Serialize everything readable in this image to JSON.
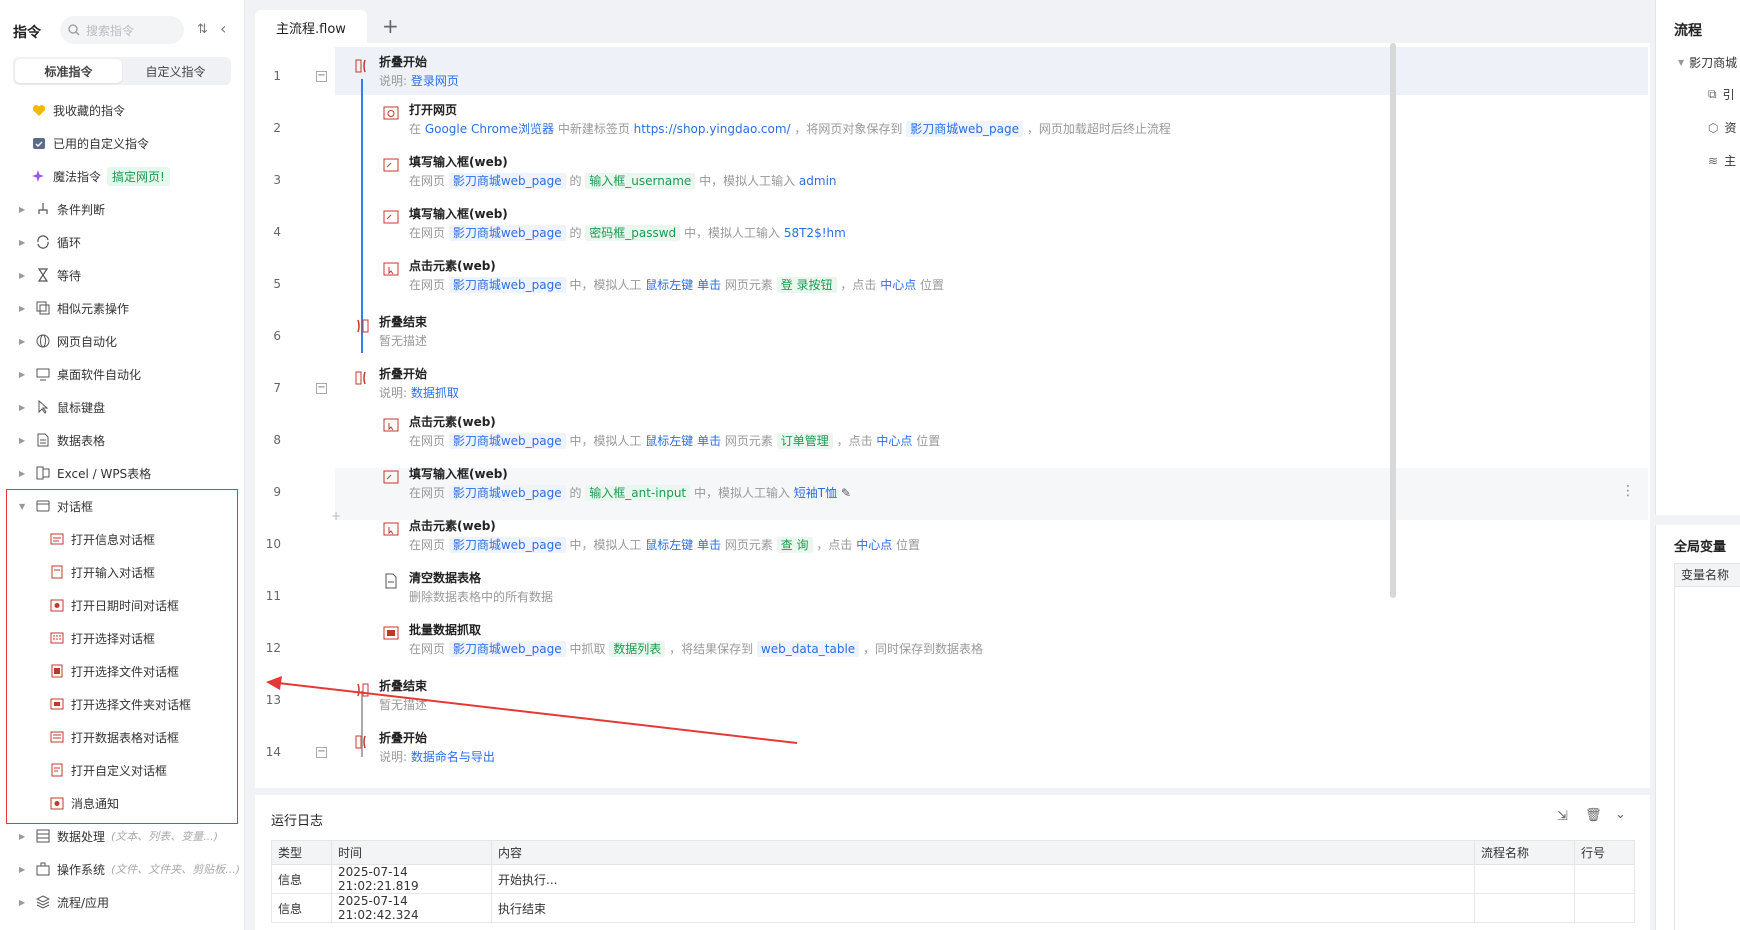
{
  "left": {
    "title": "指令",
    "search_placeholder": "搜索指令",
    "tabs": [
      "标准指令",
      "自定义指令"
    ],
    "items": [
      {
        "label": "我收藏的指令",
        "icon": "heart-icon"
      },
      {
        "label": "已用的自定义指令",
        "icon": "calendar-check-icon"
      },
      {
        "label": "魔法指令",
        "icon": "sparkle-icon",
        "tag": "搞定网页!"
      },
      {
        "label": "条件判断",
        "icon": "branch-icon"
      },
      {
        "label": "循环",
        "icon": "loop-icon"
      },
      {
        "label": "等待",
        "icon": "hourglass-icon"
      },
      {
        "label": "相似元素操作",
        "icon": "copy-icon"
      },
      {
        "label": "网页自动化",
        "icon": "globe-icon"
      },
      {
        "label": "桌面软件自动化",
        "icon": "monitor-icon"
      },
      {
        "label": "鼠标键盘",
        "icon": "cursor-icon"
      },
      {
        "label": "数据表格",
        "icon": "doc-icon"
      },
      {
        "label": "Excel / WPS表格",
        "icon": "excel-icon"
      },
      {
        "label": "对话框",
        "icon": "dialog-icon"
      }
    ],
    "dialog_children": [
      "打开信息对话框",
      "打开输入对话框",
      "打开日期时间对话框",
      "打开选择对话框",
      "打开选择文件对话框",
      "打开选择文件夹对话框",
      "打开数据表格对话框",
      "打开自定义对话框",
      "消息通知"
    ],
    "after_items": [
      {
        "label": "数据处理",
        "hint": "(文本、列表、变量...)"
      },
      {
        "label": "操作系统",
        "hint": "(文件、文件夹、剪贴板...)"
      },
      {
        "label": "流程/应用",
        "hint": ""
      }
    ]
  },
  "editor": {
    "tab": "主流程.flow",
    "add_tab": "+",
    "lines": [
      "1",
      "2",
      "3",
      "4",
      "5",
      "6",
      "7",
      "8",
      "9",
      "10",
      "11",
      "12",
      "13",
      "14"
    ],
    "steps": {
      "s1": {
        "title": "折叠开始",
        "d1": "说明:",
        "d2": "登录网页"
      },
      "s2": {
        "title": "打开网页",
        "d1": "在 ",
        "d2": "Google Chrome浏览器",
        "d3": " 中新建标签页 ",
        "d4": "https://shop.yingdao.com/",
        "d5": " ，将网页对象保存到 ",
        "d6": "影刀商城web_page",
        "d7": " ，网页加载超时后终止流程"
      },
      "s3": {
        "title": "填写输入框(web)",
        "d1": "在网页 ",
        "d2": "影刀商城web_page",
        "d3": " 的 ",
        "d4": "输入框_username",
        "d5": " 中，模拟人工输入 ",
        "d6": "admin"
      },
      "s4": {
        "title": "填写输入框(web)",
        "d1": "在网页 ",
        "d2": "影刀商城web_page",
        "d3": " 的 ",
        "d4": "密码框_passwd",
        "d5": " 中，模拟人工输入 ",
        "d6": "58T2$!hm"
      },
      "s5": {
        "title": "点击元素(web)",
        "d1": "在网页 ",
        "d2": "影刀商城web_page",
        "d3": " 中，模拟人工 ",
        "d4": "鼠标左键 单击",
        "d5": " 网页元素 ",
        "d6": "登 录按钮",
        "d7": " ，点击 ",
        "d8": "中心点",
        "d9": " 位置"
      },
      "s6": {
        "title": "折叠结束",
        "d1": "暂无描述"
      },
      "s7": {
        "title": "折叠开始",
        "d1": "说明:",
        "d2": "数据抓取"
      },
      "s8": {
        "title": "点击元素(web)",
        "d1": "在网页 ",
        "d2": "影刀商城web_page",
        "d3": " 中，模拟人工 ",
        "d4": "鼠标左键 单击",
        "d5": " 网页元素 ",
        "d6": "订单管理",
        "d7": " ，点击 ",
        "d8": "中心点",
        "d9": " 位置"
      },
      "s9": {
        "title": "填写输入框(web)",
        "d1": "在网页 ",
        "d2": "影刀商城web_page",
        "d3": " 的 ",
        "d4": "输入框_ant-input",
        "d5": " 中，模拟人工输入 ",
        "d6": "短袖T恤"
      },
      "s10": {
        "title": "点击元素(web)",
        "d1": "在网页 ",
        "d2": "影刀商城web_page",
        "d3": " 中，模拟人工 ",
        "d4": "鼠标左键 单击",
        "d5": " 网页元素 ",
        "d6": "查 询",
        "d7": " ，点击 ",
        "d8": "中心点",
        "d9": " 位置"
      },
      "s11": {
        "title": "清空数据表格",
        "d1": "删除数据表格中的所有数据"
      },
      "s12": {
        "title": "批量数据抓取",
        "d1": "在网页 ",
        "d2": "影刀商城web_page",
        "d3": " 中抓取 ",
        "d4": "数据列表",
        "d5": " ，将结果保存到 ",
        "d6": "web_data_table",
        "d7": " ，同时保存到数据表格"
      },
      "s13": {
        "title": "折叠结束",
        "d1": "暂无描述"
      },
      "s14": {
        "title": "折叠开始",
        "d1": "说明:",
        "d2": "数据命名与导出"
      }
    }
  },
  "log": {
    "title": "运行日志",
    "headers": [
      "类型",
      "时间",
      "内容",
      "流程名称",
      "行号"
    ],
    "rows": [
      [
        "信息",
        "2025-07-14 21:02:21.819",
        "开始执行...",
        "",
        ""
      ],
      [
        "信息",
        "2025-07-14 21:02:42.324",
        "执行结束",
        "",
        ""
      ]
    ]
  },
  "right": {
    "title": "流程",
    "flow_name": "影刀商城",
    "items": [
      "引",
      "资",
      "主"
    ],
    "globals_title": "全局变量",
    "var_header": "变量名称"
  },
  "colors": {
    "accent": "#3a7bea",
    "annotation": "#e53935",
    "green": "#1a9b52"
  }
}
